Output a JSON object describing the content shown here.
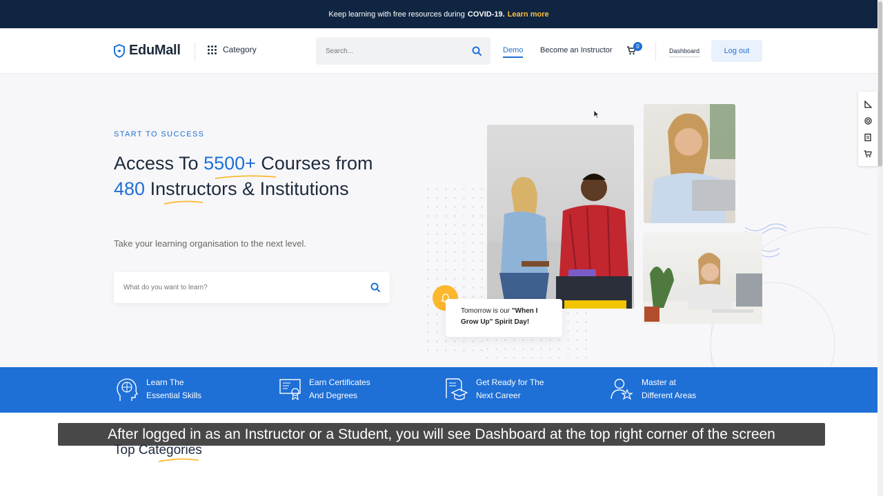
{
  "announcement": {
    "prefix": "Keep learning with free resources during",
    "highlight": "COVID-19.",
    "link": "Learn more"
  },
  "header": {
    "logo_text_bold": "EduMall",
    "category_label": "Category",
    "search_placeholder": "Search...",
    "nav": {
      "demo": "Demo",
      "become_instructor": "Become an Instructor",
      "cart_count": "0",
      "dashboard": "Dashboard",
      "logout": "Log out"
    }
  },
  "hero": {
    "eyebrow": "START TO SUCCESS",
    "headline_part1": "Access To ",
    "headline_num1": "5500+",
    "headline_part2": " Courses from ",
    "headline_num2": "480",
    "headline_part3": " Instructors & Institutions",
    "subline": "Take your learning organisation to the next level.",
    "search_placeholder": "What do you want to learn?",
    "notice_prefix": "Tomorrow is our ",
    "notice_bold": "\"When I Grow Up\" Spirit Day!"
  },
  "features": [
    {
      "line1": "Learn The",
      "line2": "Essential Skills",
      "icon": "head-brain-icon"
    },
    {
      "line1": "Earn Certificates",
      "line2": "And Degrees",
      "icon": "certificate-icon"
    },
    {
      "line1": "Get Ready for The",
      "line2": "Next Career",
      "icon": "graduation-icon"
    },
    {
      "line1": "Master at",
      "line2": "Different Areas",
      "icon": "user-star-icon"
    }
  ],
  "section": {
    "top_categories": "Top Categories"
  },
  "caption": "After logged in as an Instructor or a Student, you will see Dashboard at the top right corner of the screen",
  "colors": {
    "brand_blue": "#1e6fd6",
    "topbar_navy": "#0f2541",
    "accent_yellow": "#fbb82c"
  }
}
